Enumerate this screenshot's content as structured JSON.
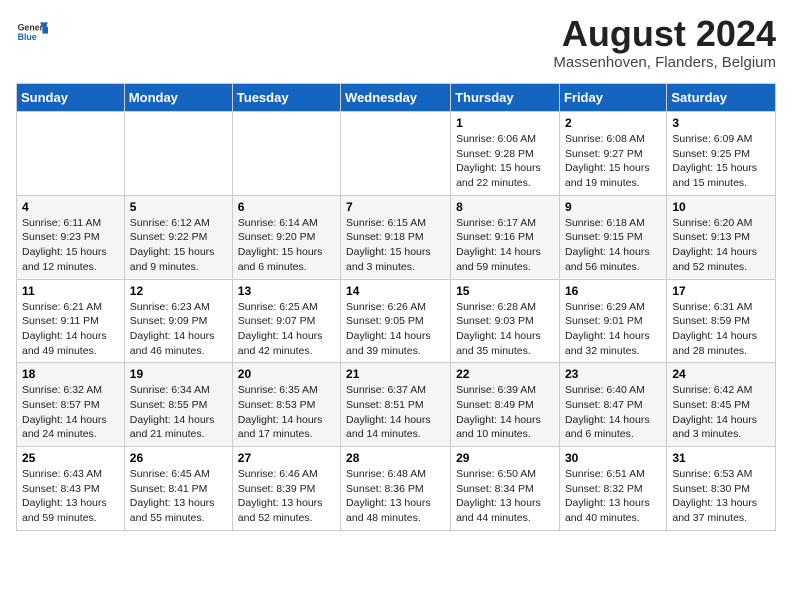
{
  "logo": {
    "general": "General",
    "blue": "Blue"
  },
  "title": {
    "month_year": "August 2024",
    "location": "Massenhoven, Flanders, Belgium"
  },
  "weekdays": [
    "Sunday",
    "Monday",
    "Tuesday",
    "Wednesday",
    "Thursday",
    "Friday",
    "Saturday"
  ],
  "weeks": [
    [
      {
        "day": "",
        "info": ""
      },
      {
        "day": "",
        "info": ""
      },
      {
        "day": "",
        "info": ""
      },
      {
        "day": "",
        "info": ""
      },
      {
        "day": "1",
        "info": "Sunrise: 6:06 AM\nSunset: 9:28 PM\nDaylight: 15 hours\nand 22 minutes."
      },
      {
        "day": "2",
        "info": "Sunrise: 6:08 AM\nSunset: 9:27 PM\nDaylight: 15 hours\nand 19 minutes."
      },
      {
        "day": "3",
        "info": "Sunrise: 6:09 AM\nSunset: 9:25 PM\nDaylight: 15 hours\nand 15 minutes."
      }
    ],
    [
      {
        "day": "4",
        "info": "Sunrise: 6:11 AM\nSunset: 9:23 PM\nDaylight: 15 hours\nand 12 minutes."
      },
      {
        "day": "5",
        "info": "Sunrise: 6:12 AM\nSunset: 9:22 PM\nDaylight: 15 hours\nand 9 minutes."
      },
      {
        "day": "6",
        "info": "Sunrise: 6:14 AM\nSunset: 9:20 PM\nDaylight: 15 hours\nand 6 minutes."
      },
      {
        "day": "7",
        "info": "Sunrise: 6:15 AM\nSunset: 9:18 PM\nDaylight: 15 hours\nand 3 minutes."
      },
      {
        "day": "8",
        "info": "Sunrise: 6:17 AM\nSunset: 9:16 PM\nDaylight: 14 hours\nand 59 minutes."
      },
      {
        "day": "9",
        "info": "Sunrise: 6:18 AM\nSunset: 9:15 PM\nDaylight: 14 hours\nand 56 minutes."
      },
      {
        "day": "10",
        "info": "Sunrise: 6:20 AM\nSunset: 9:13 PM\nDaylight: 14 hours\nand 52 minutes."
      }
    ],
    [
      {
        "day": "11",
        "info": "Sunrise: 6:21 AM\nSunset: 9:11 PM\nDaylight: 14 hours\nand 49 minutes."
      },
      {
        "day": "12",
        "info": "Sunrise: 6:23 AM\nSunset: 9:09 PM\nDaylight: 14 hours\nand 46 minutes."
      },
      {
        "day": "13",
        "info": "Sunrise: 6:25 AM\nSunset: 9:07 PM\nDaylight: 14 hours\nand 42 minutes."
      },
      {
        "day": "14",
        "info": "Sunrise: 6:26 AM\nSunset: 9:05 PM\nDaylight: 14 hours\nand 39 minutes."
      },
      {
        "day": "15",
        "info": "Sunrise: 6:28 AM\nSunset: 9:03 PM\nDaylight: 14 hours\nand 35 minutes."
      },
      {
        "day": "16",
        "info": "Sunrise: 6:29 AM\nSunset: 9:01 PM\nDaylight: 14 hours\nand 32 minutes."
      },
      {
        "day": "17",
        "info": "Sunrise: 6:31 AM\nSunset: 8:59 PM\nDaylight: 14 hours\nand 28 minutes."
      }
    ],
    [
      {
        "day": "18",
        "info": "Sunrise: 6:32 AM\nSunset: 8:57 PM\nDaylight: 14 hours\nand 24 minutes."
      },
      {
        "day": "19",
        "info": "Sunrise: 6:34 AM\nSunset: 8:55 PM\nDaylight: 14 hours\nand 21 minutes."
      },
      {
        "day": "20",
        "info": "Sunrise: 6:35 AM\nSunset: 8:53 PM\nDaylight: 14 hours\nand 17 minutes."
      },
      {
        "day": "21",
        "info": "Sunrise: 6:37 AM\nSunset: 8:51 PM\nDaylight: 14 hours\nand 14 minutes."
      },
      {
        "day": "22",
        "info": "Sunrise: 6:39 AM\nSunset: 8:49 PM\nDaylight: 14 hours\nand 10 minutes."
      },
      {
        "day": "23",
        "info": "Sunrise: 6:40 AM\nSunset: 8:47 PM\nDaylight: 14 hours\nand 6 minutes."
      },
      {
        "day": "24",
        "info": "Sunrise: 6:42 AM\nSunset: 8:45 PM\nDaylight: 14 hours\nand 3 minutes."
      }
    ],
    [
      {
        "day": "25",
        "info": "Sunrise: 6:43 AM\nSunset: 8:43 PM\nDaylight: 13 hours\nand 59 minutes."
      },
      {
        "day": "26",
        "info": "Sunrise: 6:45 AM\nSunset: 8:41 PM\nDaylight: 13 hours\nand 55 minutes."
      },
      {
        "day": "27",
        "info": "Sunrise: 6:46 AM\nSunset: 8:39 PM\nDaylight: 13 hours\nand 52 minutes."
      },
      {
        "day": "28",
        "info": "Sunrise: 6:48 AM\nSunset: 8:36 PM\nDaylight: 13 hours\nand 48 minutes."
      },
      {
        "day": "29",
        "info": "Sunrise: 6:50 AM\nSunset: 8:34 PM\nDaylight: 13 hours\nand 44 minutes."
      },
      {
        "day": "30",
        "info": "Sunrise: 6:51 AM\nSunset: 8:32 PM\nDaylight: 13 hours\nand 40 minutes."
      },
      {
        "day": "31",
        "info": "Sunrise: 6:53 AM\nSunset: 8:30 PM\nDaylight: 13 hours\nand 37 minutes."
      }
    ]
  ]
}
